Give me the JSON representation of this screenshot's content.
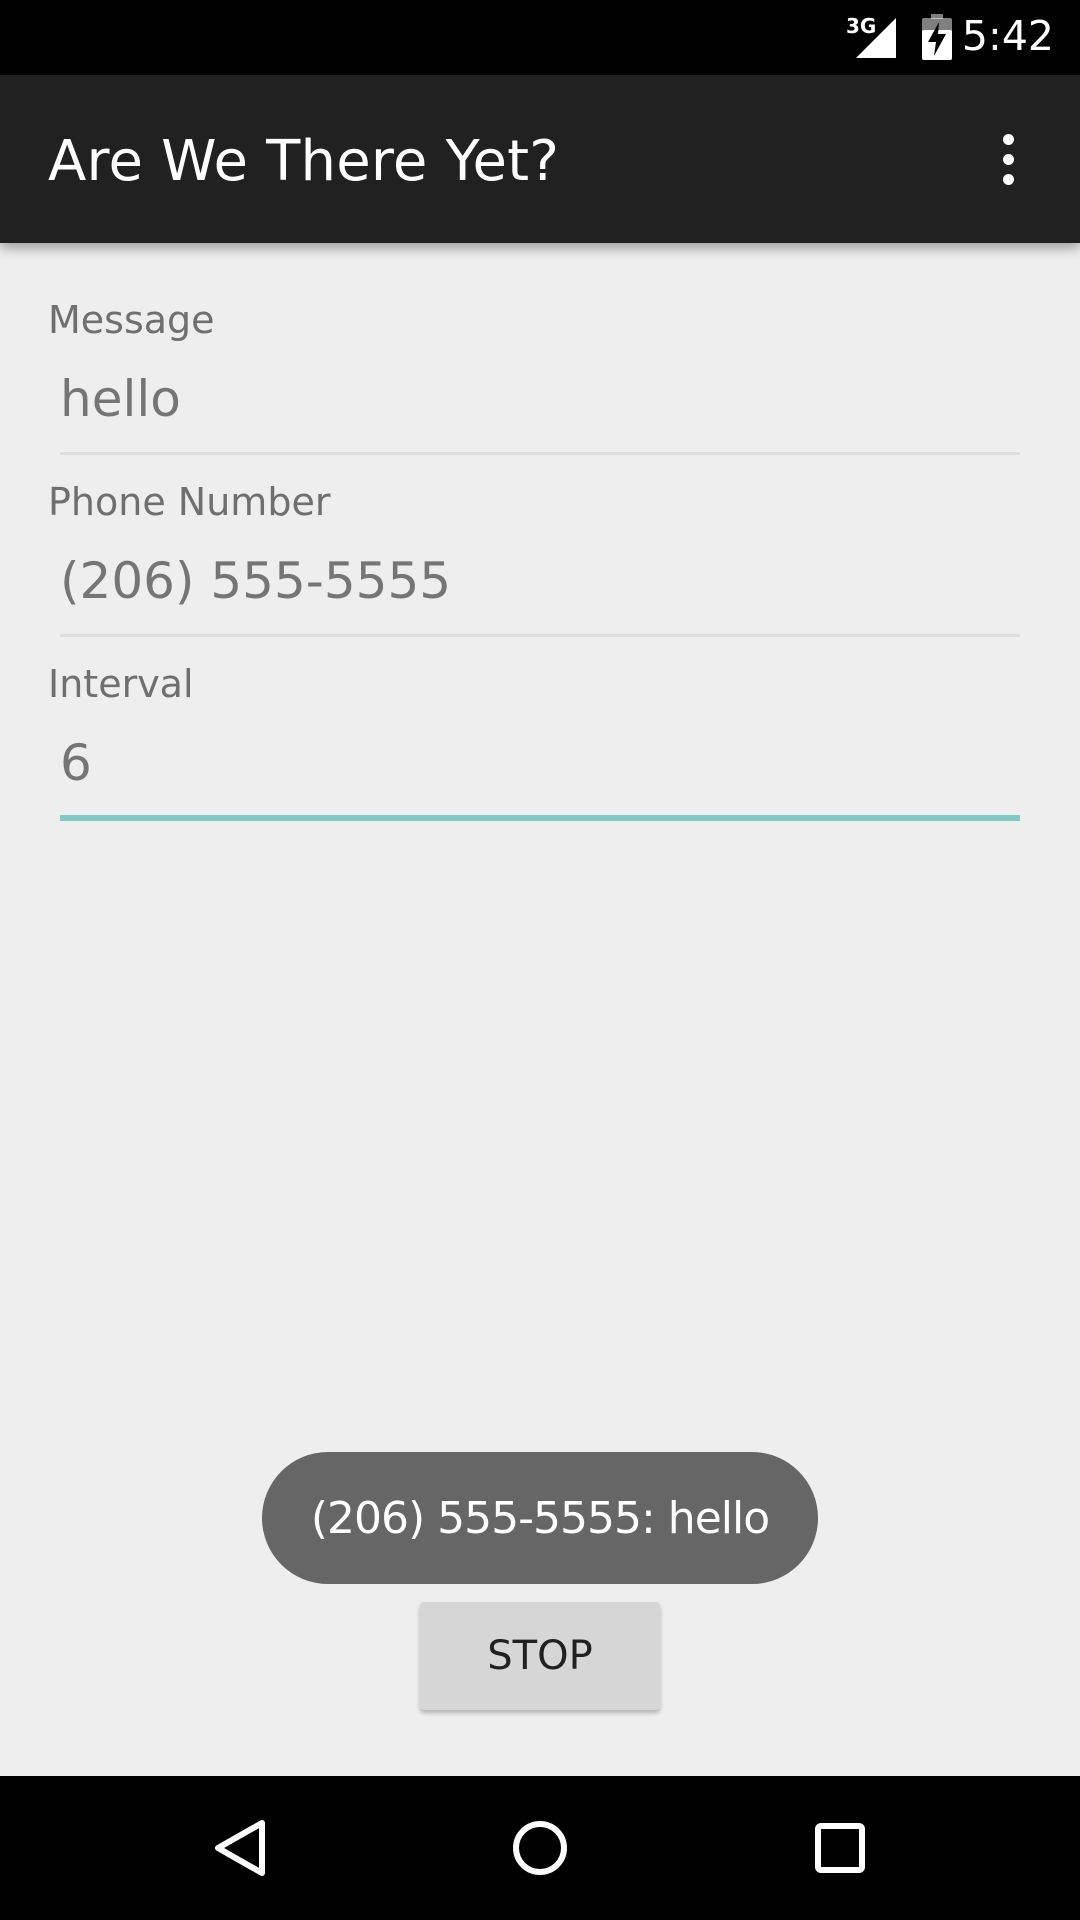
{
  "status_bar": {
    "network": "3G",
    "time": "5:42",
    "icons": [
      "signal-icon",
      "battery-charging-icon"
    ]
  },
  "app_bar": {
    "title": "Are We There Yet?",
    "menu_icon": "overflow-menu-icon"
  },
  "form": {
    "message": {
      "label": "Message",
      "placeholder": "hello",
      "value": ""
    },
    "phone": {
      "label": "Phone Number",
      "placeholder": "(206) 555-5555",
      "value": ""
    },
    "interval": {
      "label": "Interval",
      "placeholder": "6",
      "value": ""
    }
  },
  "toast": {
    "text": "(206) 555-5555: hello"
  },
  "actions": {
    "stop_label": "STOP"
  },
  "nav_bar": {
    "icons": [
      "back-icon",
      "home-icon",
      "recents-icon"
    ]
  },
  "colors": {
    "accent": "#80cbc4",
    "app_bar": "#212121",
    "background": "#eeeeee",
    "toast": "#666666"
  }
}
